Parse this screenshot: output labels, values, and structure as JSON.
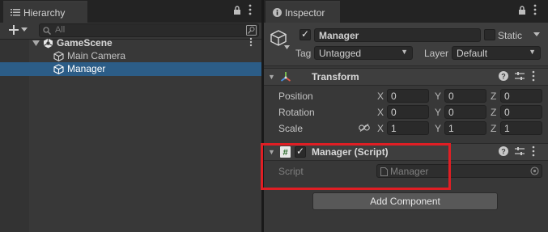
{
  "hierarchy": {
    "tab_title": "Hierarchy",
    "search_placeholder": "All",
    "scene": {
      "name": "GameScene"
    },
    "items": [
      {
        "label": "Main Camera",
        "selected": false
      },
      {
        "label": "Manager",
        "selected": true
      }
    ]
  },
  "inspector": {
    "tab_title": "Inspector",
    "object": {
      "active": true,
      "name": "Manager",
      "static_label": "Static",
      "static_checked": false,
      "tag_label": "Tag",
      "tag_value": "Untagged",
      "layer_label": "Layer",
      "layer_value": "Default"
    },
    "transform": {
      "title": "Transform",
      "rows": [
        {
          "label": "Position",
          "x": "0",
          "y": "0",
          "z": "0"
        },
        {
          "label": "Rotation",
          "x": "0",
          "y": "0",
          "z": "0"
        },
        {
          "label": "Scale",
          "x": "1",
          "y": "1",
          "z": "1"
        }
      ],
      "axis_x": "X",
      "axis_y": "Y",
      "axis_z": "Z"
    },
    "script_component": {
      "title": "Manager (Script)",
      "enabled": true,
      "field_label": "Script",
      "field_value": "Manager"
    },
    "add_component_label": "Add Component"
  },
  "colors": {
    "selection": "#2c5d87",
    "highlight_box": "#e01e24",
    "panel_bg": "#383838"
  }
}
